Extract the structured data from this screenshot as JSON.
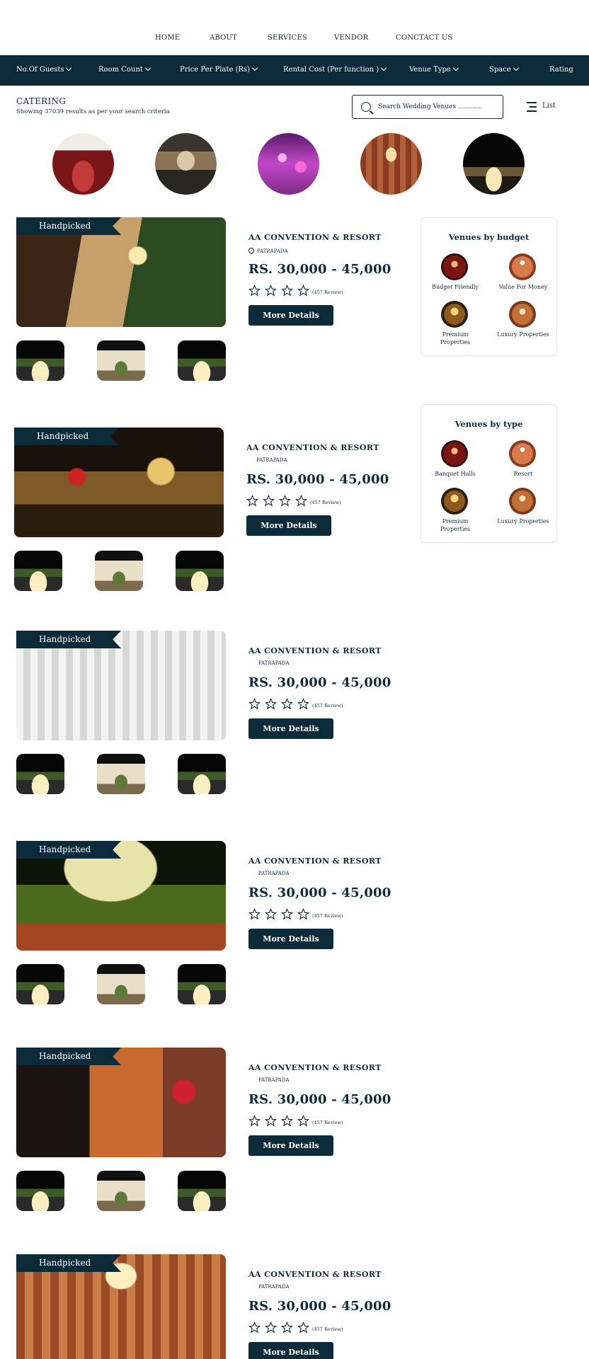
{
  "nav": {
    "items": [
      "HOME",
      "ABOUT",
      "SERVICES",
      "VENDOR",
      "CONCTACT US"
    ]
  },
  "filters": {
    "items": [
      "No.Of Guests",
      "Room Count",
      "Price Per Plate (Rs)",
      "Rental Cost (Per function )",
      "Venue Type",
      "Space",
      "Rating"
    ]
  },
  "header": {
    "title": "CATERING",
    "subtitle": "Showing 37039 results as per your search criteria"
  },
  "search": {
    "placeholder": "Search Wedding Venues ............"
  },
  "view_toggle": {
    "label": "List"
  },
  "category_images": [
    "grand-hall",
    "store-front",
    "purple-lit-hall",
    "banquet-hall",
    "night-venue"
  ],
  "listings": [
    {
      "badge": "Handpicked",
      "title": "AA CONVENTION  & RESORT",
      "location": "PATRAPADA",
      "price": "RS. 30,000 - 45,000",
      "reviews": "(457 Review)",
      "button": "More Details",
      "rating": 0
    },
    {
      "badge": "Handpicked",
      "title": "AA CONVENTION  & RESORT",
      "location": "PATRAPADA",
      "price": "RS. 30,000 - 45,000",
      "reviews": "(457 Review)",
      "button": "More Details",
      "rating": 0
    },
    {
      "badge": "Handpicked",
      "title": "AA CONVENTION  & RESORT",
      "location": "PATRAPADA",
      "price": "RS. 30,000 - 45,000",
      "reviews": "(457 Review)",
      "button": "More Details",
      "rating": 0
    },
    {
      "badge": "Handpicked",
      "title": "AA CONVENTION  & RESORT",
      "location": "PATRAPADA",
      "price": "RS. 30,000 - 45,000",
      "reviews": "(457 Review)",
      "button": "More Details",
      "rating": 0
    },
    {
      "badge": "Handpicked",
      "title": "AA CONVENTION  & RESORT",
      "location": "PATRAPADA",
      "price": "RS. 30,000 - 45,000",
      "reviews": "(457 Review)",
      "button": "More Details",
      "rating": 0
    },
    {
      "badge": "Handpicked",
      "title": "AA CONVENTION  & RESORT",
      "location": "PATRAPADA",
      "price": "RS. 30,000 - 45,000",
      "reviews": "(457 Review)",
      "button": "More Details",
      "rating": 0
    }
  ],
  "budget_card": {
    "title": "Venues by budget",
    "options": [
      "Budget Friendly",
      "Value For Money",
      "Premium Properties",
      "Luxury Properties"
    ]
  },
  "type_card": {
    "title": "Venues by type",
    "options": [
      "Banquet Halls",
      "Resort",
      "Premium Properties",
      "Luxury Properties"
    ]
  },
  "colors": {
    "primary": "#0b2a3a",
    "background": "#ffffff",
    "text": "#0c2a3a"
  },
  "icons": [
    "search-icon",
    "list-icon",
    "location-pin-icon",
    "star-icon",
    "chevron-down-icon"
  ]
}
